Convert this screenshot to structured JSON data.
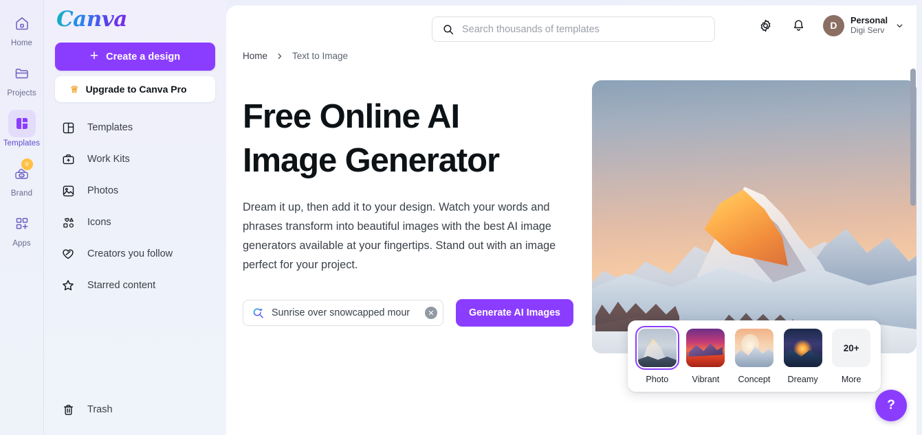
{
  "brand": {
    "logo_text": "Canva",
    "accent": "#8b3dff",
    "logo_gradient": [
      "#12b5c0",
      "#2d7ff2",
      "#7d2ae8"
    ]
  },
  "rail": {
    "items": [
      {
        "label": "Home",
        "icon": "home-icon",
        "active": false,
        "badge": null
      },
      {
        "label": "Projects",
        "icon": "folder-icon",
        "active": false,
        "badge": null
      },
      {
        "label": "Templates",
        "icon": "templates-icon",
        "active": true,
        "badge": null
      },
      {
        "label": "Brand",
        "icon": "brand-icon",
        "active": false,
        "badge": "crown"
      },
      {
        "label": "Apps",
        "icon": "apps-icon",
        "active": false,
        "badge": null
      }
    ]
  },
  "sidebar": {
    "create_label": "Create a design",
    "upgrade_label": "Upgrade to Canva Pro",
    "items": [
      {
        "label": "Templates",
        "icon": "templates-layout-icon"
      },
      {
        "label": "Work Kits",
        "icon": "briefcase-icon"
      },
      {
        "label": "Photos",
        "icon": "photo-icon"
      },
      {
        "label": "Icons",
        "icon": "shapes-icon"
      },
      {
        "label": "Creators you follow",
        "icon": "heart-icon"
      },
      {
        "label": "Starred content",
        "icon": "star-icon"
      }
    ],
    "trash_label": "Trash"
  },
  "topbar": {
    "search_placeholder": "Search thousands of templates",
    "settings_icon": "gear-icon",
    "notifications_icon": "bell-icon",
    "account": {
      "initial": "D",
      "name": "Personal",
      "subtitle": "Digi Serv",
      "avatar_color": "#8b6f63"
    }
  },
  "breadcrumb": {
    "home": "Home",
    "separator": "›",
    "current": "Text to Image"
  },
  "hero": {
    "title_line1": "Free Online AI",
    "title_line2": "Image Generator",
    "description": "Dream it up, then add it to your design. Watch your words and phrases transform into beautiful images with the best AI image generators available at your fingertips. Stand out with an image perfect for your project.",
    "prompt": {
      "icon": "magic-search-icon",
      "value": "Sunrise over snowcapped mour",
      "clear_icon": "close-icon"
    },
    "generate_label": "Generate AI Images"
  },
  "style_picker": {
    "items": [
      {
        "label": "Photo",
        "selected": true,
        "thumb": "t1"
      },
      {
        "label": "Vibrant",
        "selected": false,
        "thumb": "t2"
      },
      {
        "label": "Concept",
        "selected": false,
        "thumb": "t3"
      },
      {
        "label": "Dreamy",
        "selected": false,
        "thumb": "t4"
      }
    ],
    "more": {
      "count": "20+",
      "label": "More"
    }
  },
  "help_fab": {
    "label": "?"
  }
}
